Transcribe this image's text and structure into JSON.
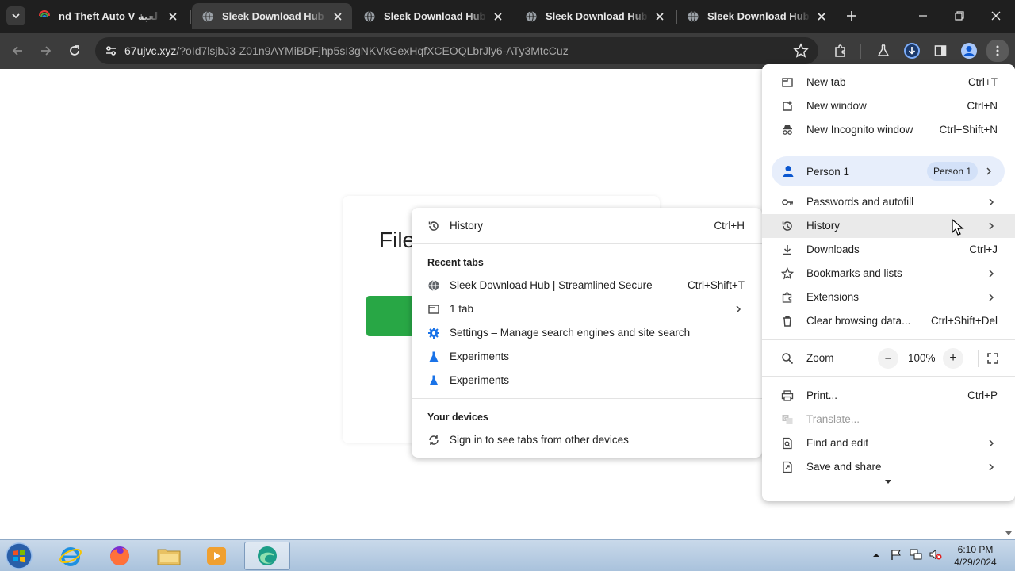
{
  "tabs": [
    {
      "title": "nd Theft Auto V تحميل لعبة",
      "active": false
    },
    {
      "title": "Sleek Download Hub | Streamlined",
      "active": true
    },
    {
      "title": "Sleek Download Hub | Streamlined",
      "active": false
    },
    {
      "title": "Sleek Download Hub | Streamlined",
      "active": false
    },
    {
      "title": "Sleek Download Hub | Streamlined",
      "active": false
    }
  ],
  "address_bar": {
    "domain": "67ujvc.xyz",
    "path": "/?oId7lsjbJ3-Z01n9AYMiBDFjhp5sI3gNKVkGexHqfXCEOQLbrJly6-ATy3MtcCuz"
  },
  "page": {
    "card_title": "File"
  },
  "history_submenu": {
    "history_label": "History",
    "history_shortcut": "Ctrl+H",
    "recent_tabs_heading": "Recent tabs",
    "items": [
      {
        "label": "Sleek Download Hub | Streamlined  Secure",
        "shortcut": "Ctrl+Shift+T",
        "icon": "globe-icon"
      },
      {
        "label": "1 tab",
        "shortcut": "",
        "icon": "window-icon"
      },
      {
        "label": "Settings – Manage search engines and site search",
        "shortcut": "",
        "icon": "gear-icon"
      },
      {
        "label": "Experiments",
        "shortcut": "",
        "icon": "flask-icon"
      },
      {
        "label": "Experiments",
        "shortcut": "",
        "icon": "flask-icon"
      }
    ],
    "devices_heading": "Your devices",
    "devices_item": "Sign in to see tabs from other devices"
  },
  "main_menu": {
    "new_tab": {
      "label": "New tab",
      "shortcut": "Ctrl+T"
    },
    "new_window": {
      "label": "New window",
      "shortcut": "Ctrl+N"
    },
    "new_incognito": {
      "label": "New Incognito window",
      "shortcut": "Ctrl+Shift+N"
    },
    "profile": {
      "label": "Person 1",
      "badge": "Person 1"
    },
    "passwords": {
      "label": "Passwords and autofill"
    },
    "history": {
      "label": "History"
    },
    "downloads": {
      "label": "Downloads",
      "shortcut": "Ctrl+J"
    },
    "bookmarks": {
      "label": "Bookmarks and lists"
    },
    "extensions": {
      "label": "Extensions"
    },
    "clear_data": {
      "label": "Clear browsing data...",
      "shortcut": "Ctrl+Shift+Del"
    },
    "zoom": {
      "label": "Zoom",
      "value": "100%",
      "minus": "−",
      "plus": "+"
    },
    "print": {
      "label": "Print...",
      "shortcut": "Ctrl+P"
    },
    "translate": {
      "label": "Translate..."
    },
    "find_edit": {
      "label": "Find and edit"
    },
    "save_share": {
      "label": "Save and share"
    }
  },
  "taskbar": {
    "time": "6:10 PM",
    "date": "4/29/2024"
  },
  "colors": {
    "tabstrip": "#1f1f1f",
    "toolbar": "#3c3c3c",
    "accent_blue": "#0b57d0",
    "button_green": "#28a745"
  }
}
